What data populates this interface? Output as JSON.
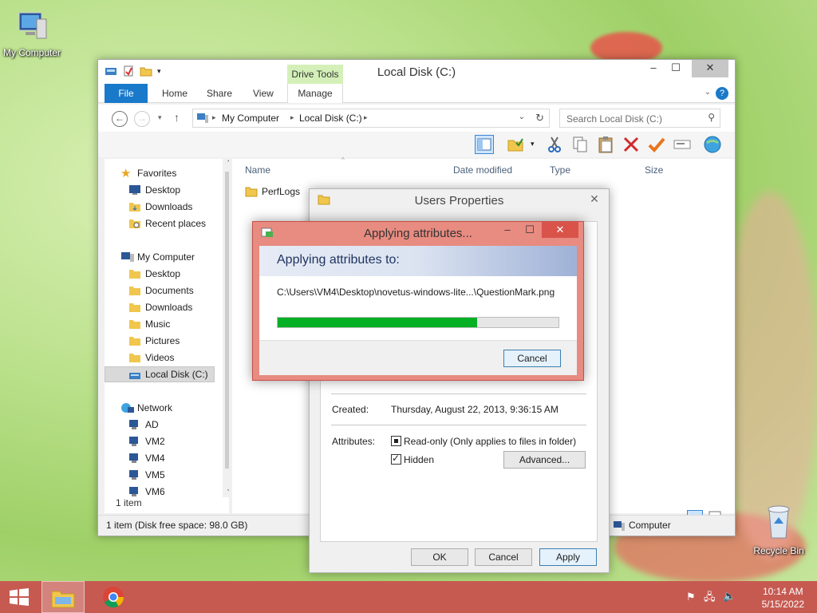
{
  "desktop": {
    "icons": [
      {
        "label": "My Computer"
      },
      {
        "label": "Recycle Bin"
      }
    ]
  },
  "explorer": {
    "title": "Local Disk (C:)",
    "ribbon": {
      "contextual_tab": "Drive Tools",
      "tabs": [
        "File",
        "Home",
        "Share",
        "View",
        "Manage"
      ]
    },
    "breadcrumb": [
      "My Computer",
      "Local Disk (C:)"
    ],
    "search_placeholder": "Search Local Disk (C:)",
    "nav": {
      "favorites": {
        "label": "Favorites",
        "items": [
          "Desktop",
          "Downloads",
          "Recent places"
        ]
      },
      "computer": {
        "label": "My Computer",
        "items": [
          "Desktop",
          "Documents",
          "Downloads",
          "Music",
          "Pictures",
          "Videos",
          "Local Disk (C:)"
        ]
      },
      "network": {
        "label": "Network",
        "items": [
          "AD",
          "VM2",
          "VM4",
          "VM5",
          "VM6"
        ]
      }
    },
    "columns": [
      "Name",
      "Date modified",
      "Type",
      "Size"
    ],
    "files": [
      {
        "name": "PerfLogs"
      }
    ],
    "item_count": "1 item",
    "status_left": "1 item (Disk free space: 98.0 GB)",
    "status_right": "Computer"
  },
  "properties": {
    "title": "Users Properties",
    "created_label": "Created:",
    "created_value": "Thursday, August 22, 2013, 9:36:15 AM",
    "attributes_label": "Attributes:",
    "readonly_label": "Read-only (Only applies to files in folder)",
    "hidden_label": "Hidden",
    "advanced_button": "Advanced...",
    "ok": "OK",
    "cancel": "Cancel",
    "apply": "Apply"
  },
  "applying": {
    "title": "Applying attributes...",
    "heading": "Applying attributes to:",
    "path": "C:\\Users\\VM4\\Desktop\\novetus-windows-lite...\\QuestionMark.png",
    "progress": 0.71,
    "cancel": "Cancel"
  },
  "taskbar": {
    "time": "10:14 AM",
    "date": "5/15/2022"
  },
  "colors": {
    "accent_blue": "#1979ca",
    "dialog_frame": "#e88b80",
    "taskbar": "#c65a51",
    "progress_green": "#06b025"
  }
}
